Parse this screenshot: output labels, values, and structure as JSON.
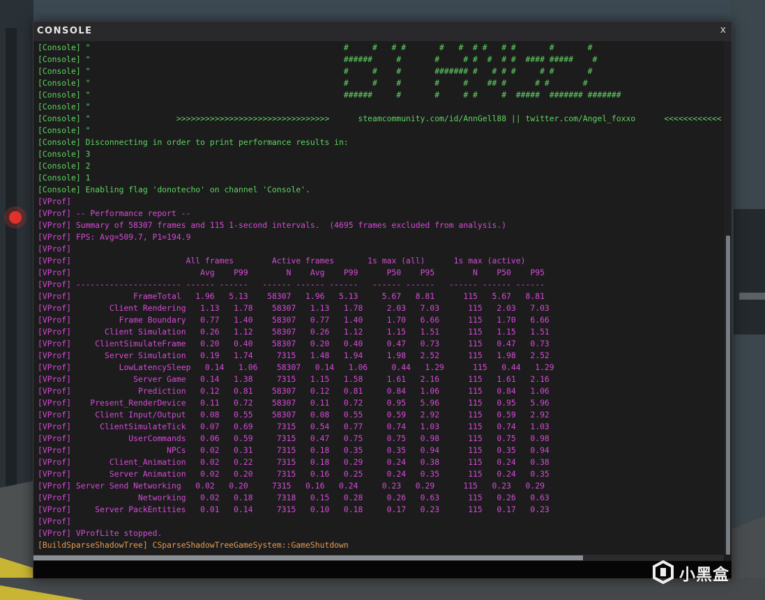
{
  "window": {
    "title": "CONSOLE",
    "close_label": "x"
  },
  "colors": {
    "console_text": "#5fd45f",
    "vprof_text": "#d64ad6",
    "warning_text": "#e39b54",
    "window_bg": "#1c1c1d"
  },
  "log": [
    {
      "type": "console",
      "text": "[Console] \"                                                     #     #   # #       #   #  # #   # #       #       #"
    },
    {
      "type": "console",
      "text": "[Console] \"                                                     ######     #       #     # #  #  # #  #### #####    #"
    },
    {
      "type": "console",
      "text": "[Console] \"                                                     #     #    #       ####### #   # # #     # #       #"
    },
    {
      "type": "console",
      "text": "[Console] \"                                                     #     #    #       #     #    ## #      # #       #"
    },
    {
      "type": "console",
      "text": "[Console] \"                                                     ######     #       #     # #     #  #####  ####### #######"
    },
    {
      "type": "console",
      "text": "[Console] \""
    },
    {
      "type": "console",
      "text": "[Console] \"                  >>>>>>>>>>>>>>>>>>>>>>>>>>>>>>>>      steamcommunity.com/id/AnnGell88 || twitter.com/Angel_foxxo      <<<<<<<<<<<<"
    },
    {
      "type": "console",
      "text": "[Console] \""
    },
    {
      "type": "console",
      "text": "[Console] Disconnecting in order to print performance results in:"
    },
    {
      "type": "console",
      "text": "[Console] 3"
    },
    {
      "type": "console",
      "text": "[Console] 2"
    },
    {
      "type": "console",
      "text": "[Console] 1"
    },
    {
      "type": "console",
      "text": "[Console] Enabling flag 'donotecho' on channel 'Console'."
    },
    {
      "type": "vprof",
      "text": "[VProf]"
    },
    {
      "type": "vprof",
      "text": "[VProf] -- Performance report --"
    },
    {
      "type": "vprof",
      "text": "[VProf] Summary of 58307 frames and 115 1-second intervals.  (4695 frames excluded from analysis.)"
    },
    {
      "type": "vprof",
      "text": "[VProf] FPS: Avg=509.7, P1=194.9"
    },
    {
      "type": "vprof",
      "text": "[VProf]"
    },
    {
      "type": "vprof",
      "text": "[VProf]                        All frames        Active frames       1s max (all)      1s max (active)"
    },
    {
      "type": "vprof",
      "text": "[VProf]                           Avg    P99        N    Avg    P99      P50    P95        N    P50    P95"
    },
    {
      "type": "vprof",
      "text": "[VProf] ---------------------- ------ ------   ------ ------ ------   ------ ------   ------ ------ ------"
    },
    {
      "type": "vprof",
      "text": "[VProf]             FrameTotal   1.96   5.13    58307   1.96   5.13     5.67   8.81      115   5.67   8.81"
    },
    {
      "type": "vprof",
      "text": "[VProf]        Client Rendering   1.13   1.78    58307   1.13   1.78     2.03   7.03      115   2.03   7.03"
    },
    {
      "type": "vprof",
      "text": "[VProf]          Frame Boundary   0.77   1.40    58307   0.77   1.40     1.70   6.66      115   1.70   6.66"
    },
    {
      "type": "vprof",
      "text": "[VProf]       Client Simulation   0.26   1.12    58307   0.26   1.12     1.15   1.51      115   1.15   1.51"
    },
    {
      "type": "vprof",
      "text": "[VProf]     ClientSimulateFrame   0.20   0.40    58307   0.20   0.40     0.47   0.73      115   0.47   0.73"
    },
    {
      "type": "vprof",
      "text": "[VProf]       Server Simulation   0.19   1.74     7315   1.48   1.94     1.98   2.52      115   1.98   2.52"
    },
    {
      "type": "vprof",
      "text": "[VProf]          LowLatencySleep   0.14   1.06    58307   0.14   1.06     0.44   1.29      115   0.44   1.29"
    },
    {
      "type": "vprof",
      "text": "[VProf]             Server Game   0.14   1.38     7315   1.15   1.58     1.61   2.16      115   1.61   2.16"
    },
    {
      "type": "vprof",
      "text": "[VProf]              Prediction   0.12   0.81    58307   0.12   0.81     0.84   1.06      115   0.84   1.06"
    },
    {
      "type": "vprof",
      "text": "[VProf]    Present_RenderDevice   0.11   0.72    58307   0.11   0.72     0.95   5.96      115   0.95   5.96"
    },
    {
      "type": "vprof",
      "text": "[VProf]     Client Input/Output   0.08   0.55    58307   0.08   0.55     0.59   2.92      115   0.59   2.92"
    },
    {
      "type": "vprof",
      "text": "[VProf]      ClientSimulateTick   0.07   0.69     7315   0.54   0.77     0.74   1.03      115   0.74   1.03"
    },
    {
      "type": "vprof",
      "text": "[VProf]            UserCommands   0.06   0.59     7315   0.47   0.75     0.75   0.98      115   0.75   0.98"
    },
    {
      "type": "vprof",
      "text": "[VProf]                    NPCs   0.02   0.31     7315   0.18   0.35     0.35   0.94      115   0.35   0.94"
    },
    {
      "type": "vprof",
      "text": "[VProf]        Client_Animation   0.02   0.22     7315   0.18   0.29     0.24   0.38      115   0.24   0.38"
    },
    {
      "type": "vprof",
      "text": "[VProf]        Server Animation   0.02   0.20     7315   0.16   0.25     0.24   0.35      115   0.24   0.35"
    },
    {
      "type": "vprof",
      "text": "[VProf] Server Send Networking   0.02   0.20     7315   0.16   0.24     0.23   0.29      115   0.23   0.29"
    },
    {
      "type": "vprof",
      "text": "[VProf]              Networking   0.02   0.18     7318   0.15   0.28     0.26   0.63      115   0.26   0.63"
    },
    {
      "type": "vprof",
      "text": "[VProf]     Server PackEntities   0.01   0.14     7315   0.10   0.18     0.17   0.23      115   0.17   0.23"
    },
    {
      "type": "vprof",
      "text": "[VProf]"
    },
    {
      "type": "vprof",
      "text": "[VProf] VProfLite stopped."
    },
    {
      "type": "warn",
      "text": "[BuildSparseShadowTree] CSparseShadowTreeGameSystem::GameShutdown"
    }
  ],
  "watermark": {
    "text": "小黑盒",
    "icon": "heybox-logo-icon"
  }
}
